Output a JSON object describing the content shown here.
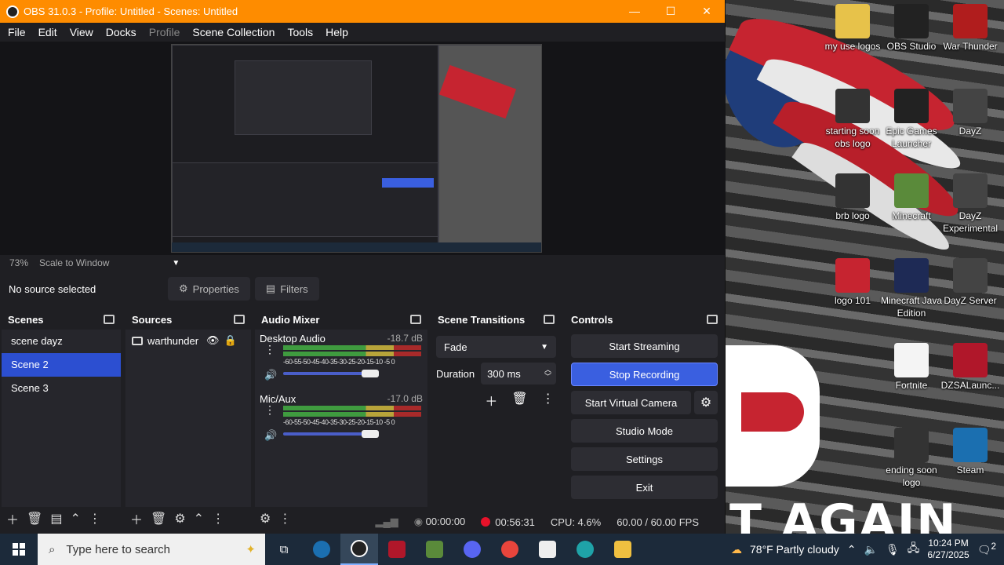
{
  "window": {
    "title": "OBS 31.0.3 - Profile: Untitled - Scenes: Untitled",
    "min": "—",
    "max": "☐",
    "close": "✕"
  },
  "menu": [
    "File",
    "Edit",
    "View",
    "Docks",
    "Profile",
    "Scene Collection",
    "Tools",
    "Help"
  ],
  "zoom": {
    "percent": "73%",
    "mode": "Scale to Window"
  },
  "source_bar": {
    "no_selection": "No source selected",
    "properties": "Properties",
    "filters": "Filters"
  },
  "docks": {
    "scenes": {
      "title": "Scenes",
      "items": [
        "scene dayz",
        "Scene 2",
        "Scene 3"
      ],
      "active_index": 1
    },
    "sources": {
      "title": "Sources",
      "items": [
        {
          "name": "warthunder"
        }
      ]
    },
    "mixer": {
      "title": "Audio Mixer",
      "channels": [
        {
          "name": "Desktop Audio",
          "db": "-18.7 dB"
        },
        {
          "name": "Mic/Aux",
          "db": "-17.0 dB"
        }
      ],
      "ticks": "-60-55-50-45-40-35-30-25-20-15-10 -5  0"
    },
    "transitions": {
      "title": "Scene Transitions",
      "type": "Fade",
      "duration_label": "Duration",
      "duration_value": "300 ms"
    },
    "controls": {
      "title": "Controls",
      "start_streaming": "Start Streaming",
      "stop_recording": "Stop Recording",
      "start_virtual_camera": "Start Virtual Camera",
      "studio_mode": "Studio Mode",
      "settings": "Settings",
      "exit": "Exit"
    }
  },
  "status": {
    "stream_time": "00:00:00",
    "rec_time": "00:56:31",
    "cpu": "CPU: 4.6%",
    "fps": "60.00 / 60.00 FPS"
  },
  "desktop_icons": [
    {
      "label": "my use logos",
      "icon": "folder-icon",
      "color": "#e7c24a"
    },
    {
      "label": "OBS Studio",
      "icon": "obs-icon",
      "color": "#222"
    },
    {
      "label": "War Thunder",
      "icon": "warthunder-icon",
      "color": "#b01d1d"
    },
    {
      "label": "starting soon obs logo",
      "icon": "image-icon",
      "color": "#333"
    },
    {
      "label": "Epic Games Launcher",
      "icon": "epic-icon",
      "color": "#222"
    },
    {
      "label": "DayZ",
      "icon": "dayz-icon",
      "color": "#444"
    },
    {
      "label": "brb logo",
      "icon": "image-icon",
      "color": "#333"
    },
    {
      "label": "Minecraft",
      "icon": "minecraft-icon",
      "color": "#5a8a3a"
    },
    {
      "label": "DayZ Experimental",
      "icon": "dayz-icon",
      "color": "#444"
    },
    {
      "label": "logo 101",
      "icon": "image-icon",
      "color": "#c62430"
    },
    {
      "label": "Minecraft Java Edition",
      "icon": "minecraft-java-icon",
      "color": "#1e2a55"
    },
    {
      "label": "DayZ Server",
      "icon": "dayz-icon",
      "color": "#444"
    },
    {
      "label": "Fortnite",
      "icon": "file-icon",
      "color": "#f4f4f4"
    },
    {
      "label": "DZSALaunc...",
      "icon": "dzsa-icon",
      "color": "#b0172a"
    },
    {
      "label": "ending soon logo",
      "icon": "image-icon",
      "color": "#333"
    },
    {
      "label": "Steam",
      "icon": "steam-icon",
      "color": "#1b6fb0"
    }
  ],
  "taskbar": {
    "search_placeholder": "Type here to search",
    "weather": "78°F  Partly cloudy",
    "time": "10:24 PM",
    "date": "6/27/2025",
    "notifications": "2"
  }
}
